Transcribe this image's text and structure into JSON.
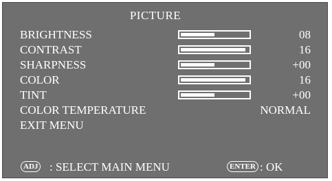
{
  "menu": {
    "title": "PICTURE",
    "items": [
      {
        "label": "BRIGHTNESS",
        "level": 0.5,
        "value": "08"
      },
      {
        "label": "CONTRAST",
        "level": 0.96,
        "value": "16"
      },
      {
        "label": "SHARPNESS",
        "level": 0.5,
        "value": "+00"
      },
      {
        "label": "COLOR",
        "level": 0.96,
        "value": "16"
      },
      {
        "label": "TINT",
        "level": 0.5,
        "value": "+00"
      }
    ],
    "color_temperature": {
      "label": "COLOR TEMPERATURE",
      "value": "NORMAL"
    },
    "exit": {
      "label": "EXIT MENU"
    }
  },
  "footer": {
    "adj_key": "ADJ",
    "adj_text": ": SELECT MAIN MENU",
    "enter_key": "ENTER",
    "enter_text": ": OK"
  },
  "colors": {
    "background": "#6f6f6f",
    "foreground": "#ffffff"
  }
}
